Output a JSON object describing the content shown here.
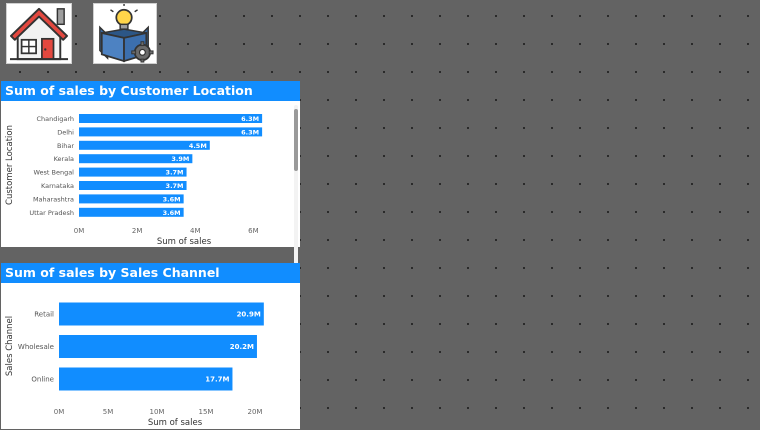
{
  "icons": {
    "home": "home-icon",
    "insight": "idea-box-icon"
  },
  "colors": {
    "accent": "#118dff",
    "canvas": "#636363",
    "panel": "#ffffff"
  },
  "location_panel": {
    "title": "Sum of sales by Customer Location"
  },
  "channel_panel": {
    "title": "Sum of sales by Sales Channel"
  },
  "chart_data": [
    {
      "type": "bar",
      "orientation": "horizontal",
      "title": "Sum of sales by Customer Location",
      "xlabel": "Sum of sales",
      "ylabel": "Customer Location",
      "categories": [
        "Chandigarh",
        "Delhi",
        "Bihar",
        "Kerala",
        "West Bengal",
        "Karnataka",
        "Maharashtra",
        "Uttar Pradesh"
      ],
      "values": [
        6.3,
        6.3,
        4.5,
        3.9,
        3.7,
        3.7,
        3.6,
        3.6
      ],
      "value_labels": [
        "6.3M",
        "6.3M",
        "4.5M",
        "3.9M",
        "3.7M",
        "3.7M",
        "3.6M",
        "3.6M"
      ],
      "unit": "M",
      "xlim": [
        0,
        7.5
      ],
      "xticks": [
        0,
        2,
        4,
        6
      ],
      "xtick_labels": [
        "0M",
        "2M",
        "4M",
        "6M"
      ],
      "grid": false,
      "bar_color": "#118dff"
    },
    {
      "type": "bar",
      "orientation": "horizontal",
      "title": "Sum of sales by Sales Channel",
      "xlabel": "Sum of sales",
      "ylabel": "Sales Channel",
      "categories": [
        "Retail",
        "Wholesale",
        "Online"
      ],
      "values": [
        20.9,
        20.2,
        17.7
      ],
      "value_labels": [
        "20.9M",
        "20.2M",
        "17.7M"
      ],
      "unit": "M",
      "xlim": [
        0,
        25
      ],
      "xticks": [
        0,
        5,
        10,
        15,
        20
      ],
      "xtick_labels": [
        "0M",
        "5M",
        "10M",
        "15M",
        "20M"
      ],
      "grid": false,
      "bar_color": "#118dff"
    }
  ]
}
